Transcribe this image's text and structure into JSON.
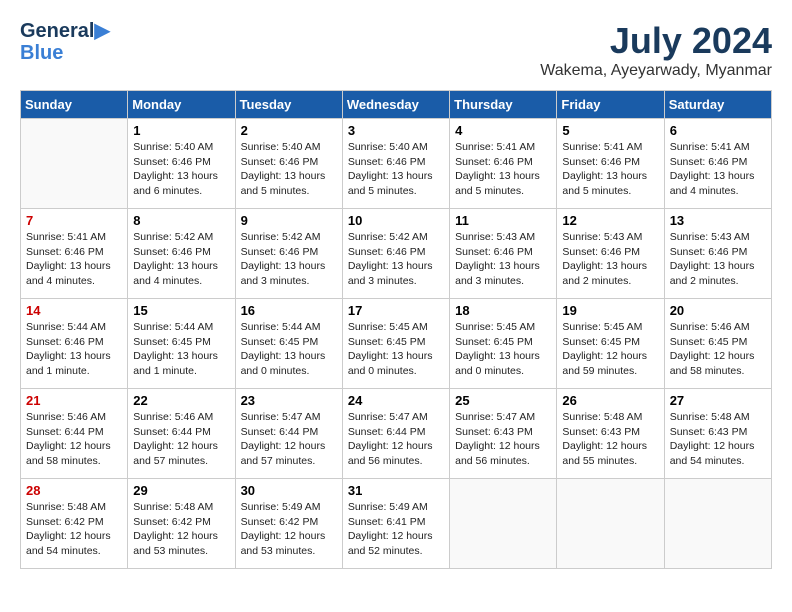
{
  "header": {
    "logo_line1": "General",
    "logo_line2": "Blue",
    "month": "July 2024",
    "location": "Wakema, Ayeyarwady, Myanmar"
  },
  "weekdays": [
    "Sunday",
    "Monday",
    "Tuesday",
    "Wednesday",
    "Thursday",
    "Friday",
    "Saturday"
  ],
  "weeks": [
    [
      {
        "day": "",
        "info": ""
      },
      {
        "day": "1",
        "info": "Sunrise: 5:40 AM\nSunset: 6:46 PM\nDaylight: 13 hours\nand 6 minutes."
      },
      {
        "day": "2",
        "info": "Sunrise: 5:40 AM\nSunset: 6:46 PM\nDaylight: 13 hours\nand 5 minutes."
      },
      {
        "day": "3",
        "info": "Sunrise: 5:40 AM\nSunset: 6:46 PM\nDaylight: 13 hours\nand 5 minutes."
      },
      {
        "day": "4",
        "info": "Sunrise: 5:41 AM\nSunset: 6:46 PM\nDaylight: 13 hours\nand 5 minutes."
      },
      {
        "day": "5",
        "info": "Sunrise: 5:41 AM\nSunset: 6:46 PM\nDaylight: 13 hours\nand 5 minutes."
      },
      {
        "day": "6",
        "info": "Sunrise: 5:41 AM\nSunset: 6:46 PM\nDaylight: 13 hours\nand 4 minutes."
      }
    ],
    [
      {
        "day": "7",
        "info": "Sunrise: 5:41 AM\nSunset: 6:46 PM\nDaylight: 13 hours\nand 4 minutes."
      },
      {
        "day": "8",
        "info": "Sunrise: 5:42 AM\nSunset: 6:46 PM\nDaylight: 13 hours\nand 4 minutes."
      },
      {
        "day": "9",
        "info": "Sunrise: 5:42 AM\nSunset: 6:46 PM\nDaylight: 13 hours\nand 3 minutes."
      },
      {
        "day": "10",
        "info": "Sunrise: 5:42 AM\nSunset: 6:46 PM\nDaylight: 13 hours\nand 3 minutes."
      },
      {
        "day": "11",
        "info": "Sunrise: 5:43 AM\nSunset: 6:46 PM\nDaylight: 13 hours\nand 3 minutes."
      },
      {
        "day": "12",
        "info": "Sunrise: 5:43 AM\nSunset: 6:46 PM\nDaylight: 13 hours\nand 2 minutes."
      },
      {
        "day": "13",
        "info": "Sunrise: 5:43 AM\nSunset: 6:46 PM\nDaylight: 13 hours\nand 2 minutes."
      }
    ],
    [
      {
        "day": "14",
        "info": "Sunrise: 5:44 AM\nSunset: 6:46 PM\nDaylight: 13 hours\nand 1 minute."
      },
      {
        "day": "15",
        "info": "Sunrise: 5:44 AM\nSunset: 6:45 PM\nDaylight: 13 hours\nand 1 minute."
      },
      {
        "day": "16",
        "info": "Sunrise: 5:44 AM\nSunset: 6:45 PM\nDaylight: 13 hours\nand 0 minutes."
      },
      {
        "day": "17",
        "info": "Sunrise: 5:45 AM\nSunset: 6:45 PM\nDaylight: 13 hours\nand 0 minutes."
      },
      {
        "day": "18",
        "info": "Sunrise: 5:45 AM\nSunset: 6:45 PM\nDaylight: 13 hours\nand 0 minutes."
      },
      {
        "day": "19",
        "info": "Sunrise: 5:45 AM\nSunset: 6:45 PM\nDaylight: 12 hours\nand 59 minutes."
      },
      {
        "day": "20",
        "info": "Sunrise: 5:46 AM\nSunset: 6:45 PM\nDaylight: 12 hours\nand 58 minutes."
      }
    ],
    [
      {
        "day": "21",
        "info": "Sunrise: 5:46 AM\nSunset: 6:44 PM\nDaylight: 12 hours\nand 58 minutes."
      },
      {
        "day": "22",
        "info": "Sunrise: 5:46 AM\nSunset: 6:44 PM\nDaylight: 12 hours\nand 57 minutes."
      },
      {
        "day": "23",
        "info": "Sunrise: 5:47 AM\nSunset: 6:44 PM\nDaylight: 12 hours\nand 57 minutes."
      },
      {
        "day": "24",
        "info": "Sunrise: 5:47 AM\nSunset: 6:44 PM\nDaylight: 12 hours\nand 56 minutes."
      },
      {
        "day": "25",
        "info": "Sunrise: 5:47 AM\nSunset: 6:43 PM\nDaylight: 12 hours\nand 56 minutes."
      },
      {
        "day": "26",
        "info": "Sunrise: 5:48 AM\nSunset: 6:43 PM\nDaylight: 12 hours\nand 55 minutes."
      },
      {
        "day": "27",
        "info": "Sunrise: 5:48 AM\nSunset: 6:43 PM\nDaylight: 12 hours\nand 54 minutes."
      }
    ],
    [
      {
        "day": "28",
        "info": "Sunrise: 5:48 AM\nSunset: 6:42 PM\nDaylight: 12 hours\nand 54 minutes."
      },
      {
        "day": "29",
        "info": "Sunrise: 5:48 AM\nSunset: 6:42 PM\nDaylight: 12 hours\nand 53 minutes."
      },
      {
        "day": "30",
        "info": "Sunrise: 5:49 AM\nSunset: 6:42 PM\nDaylight: 12 hours\nand 53 minutes."
      },
      {
        "day": "31",
        "info": "Sunrise: 5:49 AM\nSunset: 6:41 PM\nDaylight: 12 hours\nand 52 minutes."
      },
      {
        "day": "",
        "info": ""
      },
      {
        "day": "",
        "info": ""
      },
      {
        "day": "",
        "info": ""
      }
    ]
  ]
}
